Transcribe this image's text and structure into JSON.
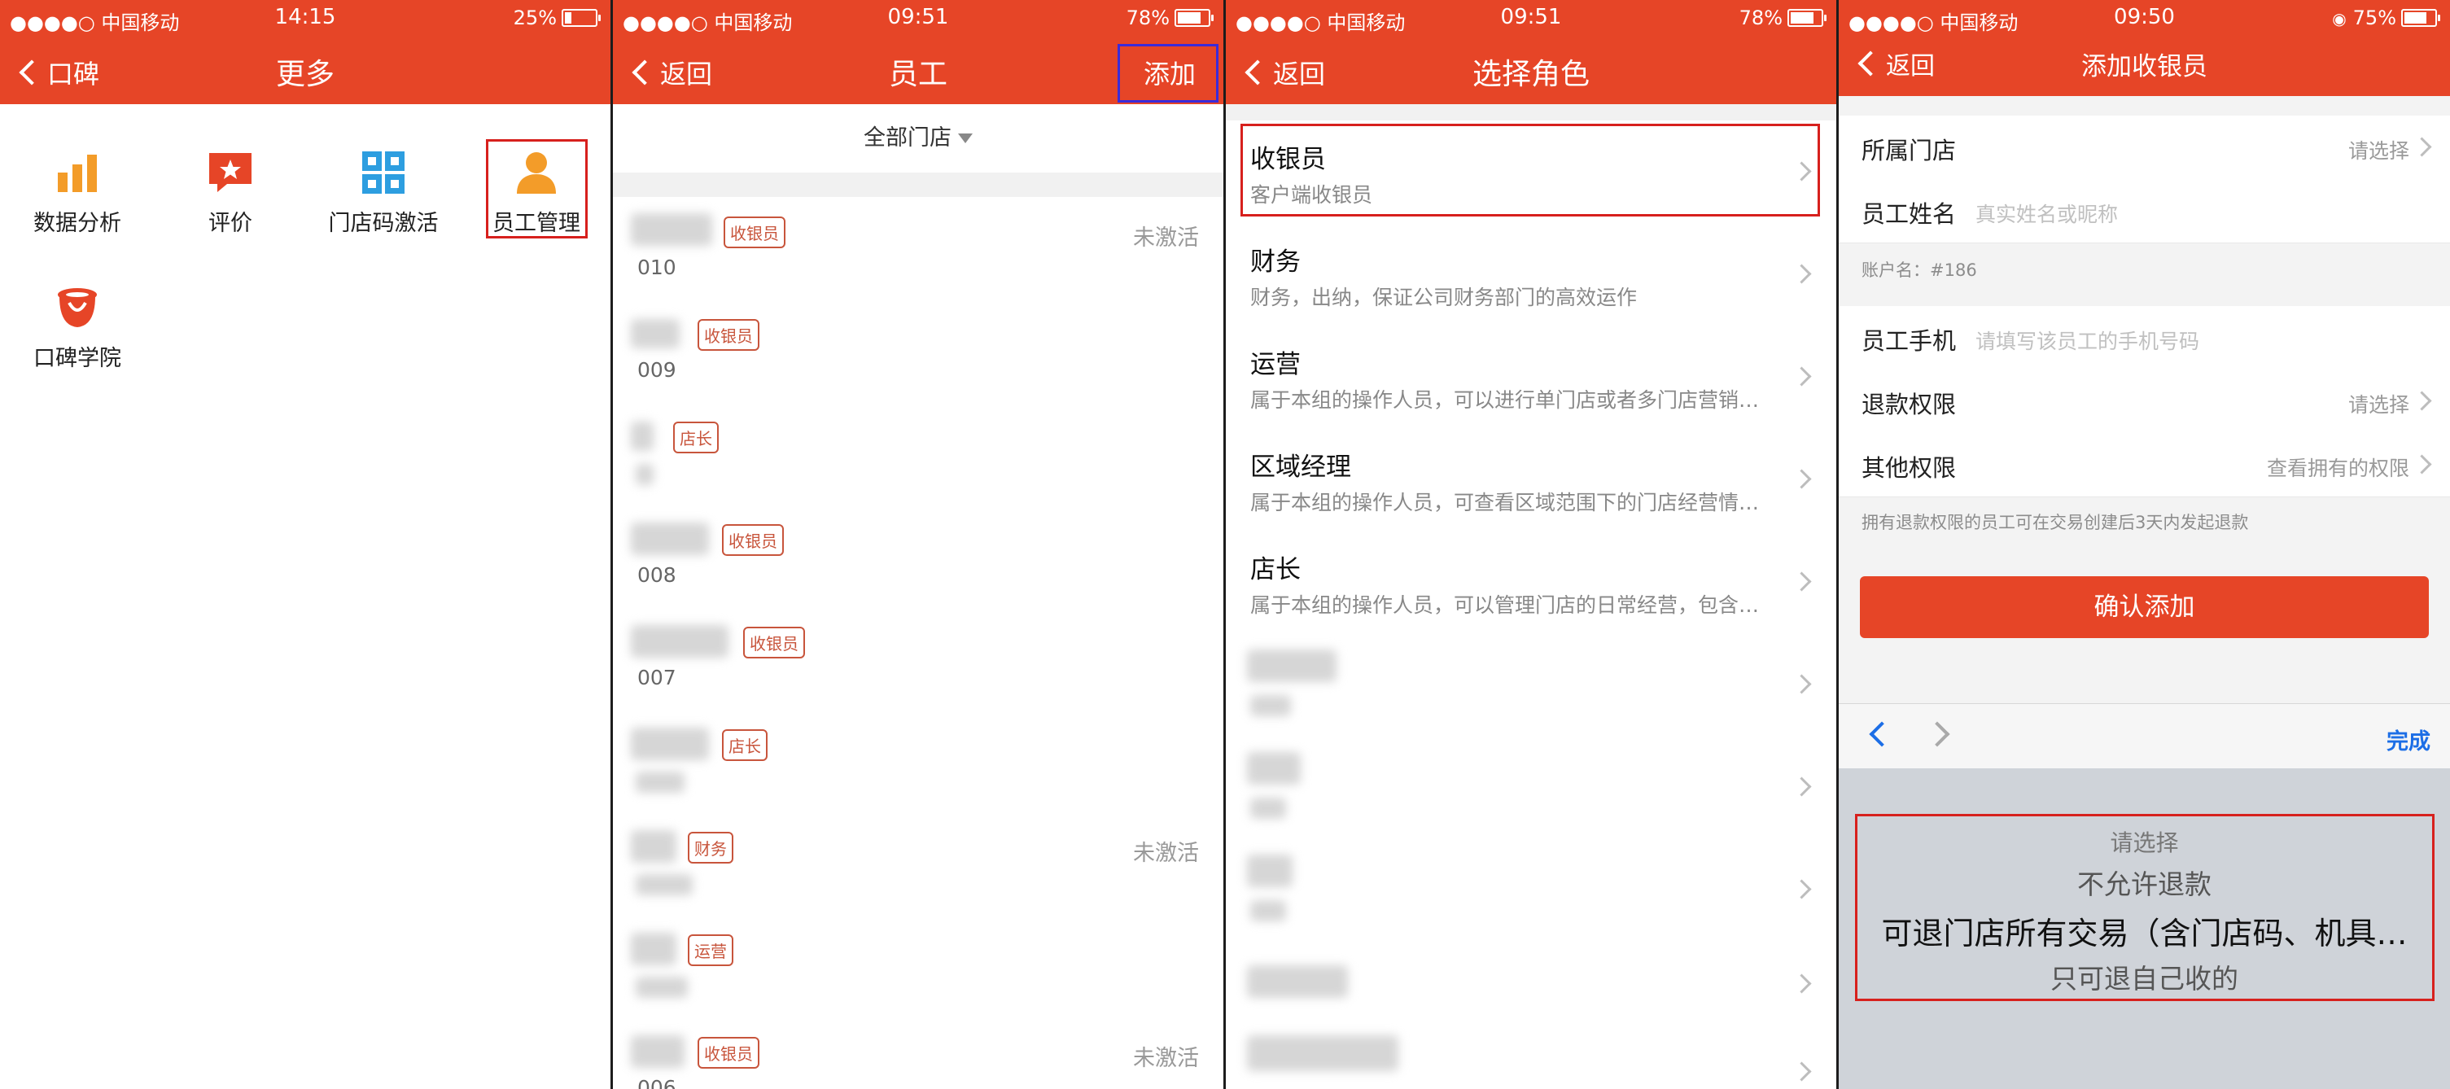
{
  "status": {
    "s1": {
      "carrier": "●●●●○ 中国移动",
      "time": "14:15",
      "battery": "25%",
      "battery_level": 0.25
    },
    "s2": {
      "carrier": "●●●●○ 中国移动",
      "time": "09:51",
      "battery": "78%",
      "battery_level": 0.78
    },
    "s3": {
      "carrier": "●●●●○ 中国移动",
      "time": "09:51",
      "battery": "78%",
      "battery_level": 0.78
    },
    "s4": {
      "carrier": "●●●●○ 中国移动",
      "time": "09:50",
      "battery": "75%",
      "battery_level": 0.75
    }
  },
  "screen1": {
    "back": "口碑",
    "title": "更多",
    "tiles": [
      "数据分析",
      "评价",
      "门店码激活",
      "员工管理",
      "口碑学院"
    ]
  },
  "screen2": {
    "back": "返回",
    "title": "员工",
    "add": "添加",
    "filter": "全部门店",
    "employees": [
      {
        "tag": "收银员",
        "code": "010",
        "status": "未激活"
      },
      {
        "tag": "收银员",
        "code": "009",
        "status": ""
      },
      {
        "tag": "店长",
        "code": "",
        "status": ""
      },
      {
        "tag": "收银员",
        "code": "008",
        "status": ""
      },
      {
        "tag": "收银员",
        "code": "007",
        "status": ""
      },
      {
        "tag": "店长",
        "code": "",
        "status": ""
      },
      {
        "tag": "财务",
        "code": "",
        "status": "未激活"
      },
      {
        "tag": "运营",
        "code": "",
        "status": ""
      },
      {
        "tag": "收银员",
        "code": "006",
        "status": "未激活"
      }
    ]
  },
  "screen3": {
    "back": "返回",
    "title": "选择角色",
    "roles": [
      {
        "name": "收银员",
        "desc": "客户端收银员"
      },
      {
        "name": "财务",
        "desc": "财务，出纳，保证公司财务部门的高效运作"
      },
      {
        "name": "运营",
        "desc": "属于本组的操作人员，可以进行单门店或者多门店营销…"
      },
      {
        "name": "区域经理",
        "desc": "属于本组的操作人员，可查看区域范围下的门店经营情…"
      },
      {
        "name": "店长",
        "desc": "属于本组的操作人员，可以管理门店的日常经营，包含…"
      }
    ]
  },
  "screen4": {
    "back": "返回",
    "title": "添加收银员",
    "store_label": "所属门店",
    "store_value": "请选择",
    "name_label": "员工姓名",
    "name_placeholder": "真实姓名或昵称",
    "account_note": "账户名：#186",
    "phone_label": "员工手机",
    "phone_placeholder": "请填写该员工的手机号码",
    "refund_label": "退款权限",
    "refund_value": "请选择",
    "other_label": "其他权限",
    "other_value": "查看拥有的权限",
    "refund_note": "拥有退款权限的员工可在交易创建后3天内发起退款",
    "confirm": "确认添加",
    "done": "完成",
    "picker": [
      "请选择",
      "不允许退款",
      "可退门店所有交易（含门店码、机具…",
      "只可退自己收的"
    ]
  },
  "colors": {
    "brand": "#e64527",
    "highlight_red": "#d7201d",
    "highlight_blue": "#3b2bd9",
    "link_blue": "#1c6ee6"
  }
}
